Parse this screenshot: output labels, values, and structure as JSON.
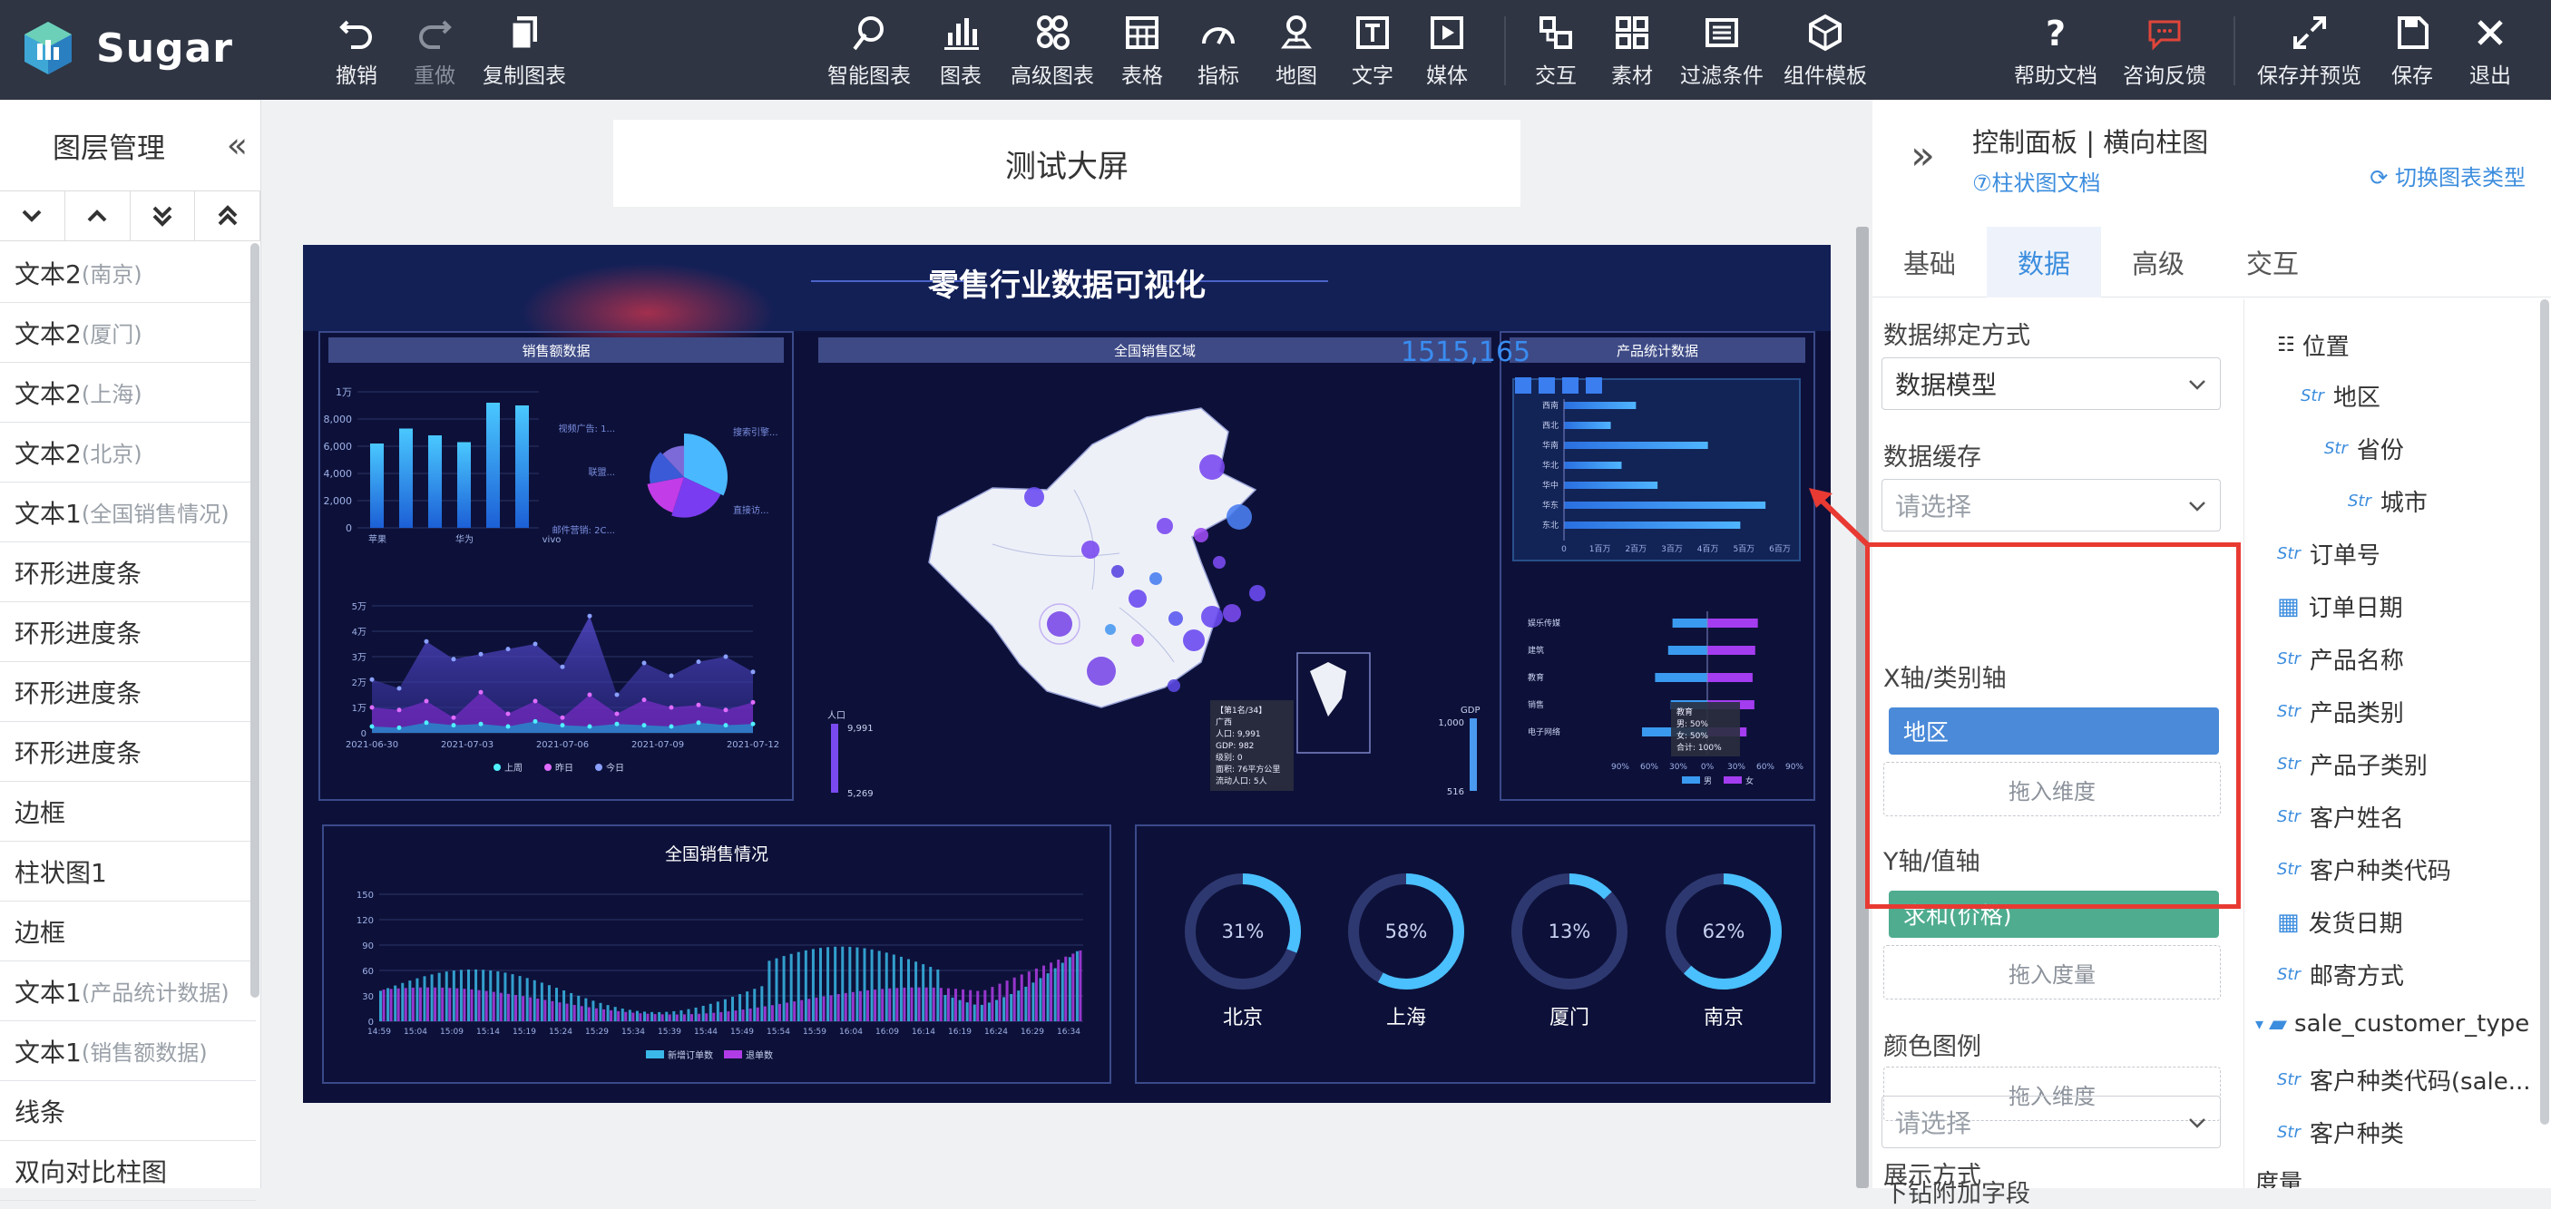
{
  "app": {
    "name": "Sugar"
  },
  "toolbar": {
    "undo": "撤销",
    "redo": "重做",
    "copy_chart": "复制图表",
    "smart_chart": "智能图表",
    "chart": "图表",
    "advanced_chart": "高级图表",
    "table": "表格",
    "indicator": "指标",
    "map": "地图",
    "text": "文字",
    "media": "媒体",
    "interaction": "交互",
    "material": "素材",
    "filter": "过滤条件",
    "component_template": "组件模板",
    "help_docs": "帮助文档",
    "consult": "咨询反馈",
    "save_preview": "保存并预览",
    "save": "保存",
    "exit": "退出"
  },
  "sidebar": {
    "title": "图层管理",
    "layers": [
      {
        "name": "文本2",
        "sub": "(南京)"
      },
      {
        "name": "文本2",
        "sub": "(厦门)"
      },
      {
        "name": "文本2",
        "sub": "(上海)"
      },
      {
        "name": "文本2",
        "sub": "(北京)"
      },
      {
        "name": "文本1",
        "sub": "(全国销售情况)"
      },
      {
        "name": "环形进度条",
        "sub": ""
      },
      {
        "name": "环形进度条",
        "sub": ""
      },
      {
        "name": "环形进度条",
        "sub": ""
      },
      {
        "name": "环形进度条",
        "sub": ""
      },
      {
        "name": "边框",
        "sub": ""
      },
      {
        "name": "柱状图1",
        "sub": ""
      },
      {
        "name": "边框",
        "sub": ""
      },
      {
        "name": "文本1",
        "sub": "(产品统计数据)"
      },
      {
        "name": "文本1",
        "sub": "(销售额数据)"
      },
      {
        "name": "线条",
        "sub": ""
      },
      {
        "name": "双向对比柱图",
        "sub": ""
      }
    ]
  },
  "canvas": {
    "title": "测试大屏"
  },
  "dashboard": {
    "title": "零售行业数据可视化",
    "panel_sales": "销售额数据",
    "panel_region": "全国销售区域",
    "panel_product": "产品统计数据",
    "big_number": "1515,165",
    "national_sales": "全国销售情况",
    "bar_yticks": [
      "1万",
      "8,000",
      "6,000",
      "4,000",
      "2,000",
      "0"
    ],
    "bar_xlabels": [
      "苹果",
      "华为",
      "vivo"
    ],
    "bar_values": [
      6200,
      7300,
      6800,
      6300,
      9200,
      9000
    ],
    "pie_labels": [
      "搜索引擎...",
      "视频广告: 1...",
      "联盟...",
      "直接访...",
      "邮件营销: 2C..."
    ],
    "area_yticks": [
      "5万",
      "4万",
      "3万",
      "2万",
      "1万",
      "0"
    ],
    "area_xlabels": [
      "2021-06-30",
      "2021-07-03",
      "2021-07-06",
      "2021-07-09",
      "2021-07-12"
    ],
    "area_legend": [
      "上周",
      "昨日",
      "今日"
    ],
    "map_legend_left": {
      "label": "人口",
      "max": "9,991",
      "min": "5,269"
    },
    "map_legend_right": {
      "label": "GDP",
      "max": "1,000",
      "min": "516"
    },
    "map_tooltip": [
      "【第1名/34】",
      "广西",
      "人口: 9,991",
      "GDP: 982",
      "级别: 0",
      "面积: 76平方公里",
      "流动人口: 5人"
    ],
    "hbar_categories": [
      "西南",
      "西北",
      "华南",
      "华北",
      "华中",
      "华东",
      "东北"
    ],
    "hbar_values": [
      2.0,
      1.3,
      4.0,
      1.6,
      2.6,
      5.6,
      4.9
    ],
    "hbar_ticks": [
      "0",
      "1百万",
      "2百万",
      "3百万",
      "4百万",
      "5百万",
      "6百万"
    ],
    "compare_categories": [
      "娱乐传媒",
      "建筑",
      "教育",
      "销售",
      "电子网络"
    ],
    "compare_ticks": [
      "90%",
      "60%",
      "30%",
      "0%",
      "30%",
      "60%",
      "90%"
    ],
    "compare_legend": [
      "男",
      "女"
    ],
    "compare_tooltip": [
      "教育",
      "男: 50%",
      "女: 50%",
      "合计: 100%"
    ],
    "national_yticks": [
      "150",
      "120",
      "90",
      "60",
      "30",
      "0"
    ],
    "national_xticks": [
      "14:59",
      "15:04",
      "15:09",
      "15:14",
      "15:19",
      "15:24",
      "15:29",
      "15:34",
      "15:39",
      "15:44",
      "15:49",
      "15:54",
      "15:59",
      "16:04",
      "16:09",
      "16:14",
      "16:19",
      "16:24",
      "16:29",
      "16:34"
    ],
    "national_legend": [
      "新增订单数",
      "退单数"
    ],
    "rings": [
      {
        "pct": 31,
        "label": "31%",
        "city": "北京"
      },
      {
        "pct": 58,
        "label": "58%",
        "city": "上海"
      },
      {
        "pct": 13,
        "label": "13%",
        "city": "厦门"
      },
      {
        "pct": 62,
        "label": "62%",
        "city": "南京"
      }
    ]
  },
  "panel": {
    "title": "控制面板 | 横向柱图",
    "doc_link": "⑦柱状图文档",
    "switch_type": "切换图表类型",
    "tabs": [
      "基础",
      "数据",
      "高级",
      "交互"
    ],
    "active_tab": "数据",
    "binding_label": "数据绑定方式",
    "binding_value": "数据模型",
    "cache_label": "数据缓存",
    "cache_placeholder": "请选择",
    "x_axis_label": "X轴/类别轴",
    "x_axis_chip": "地区",
    "x_drop": "拖入维度",
    "y_axis_label": "Y轴/值轴",
    "y_axis_chip": "求和(价格)",
    "y_drop": "拖入度量",
    "color_legend_label": "颜色图例",
    "color_drop": "拖入维度",
    "display_label": "展示方式",
    "display_placeholder": "请选择",
    "extra_label": "下钻附加字段",
    "fields": {
      "position": "位置",
      "region": "地区",
      "province": "省份",
      "city": "城市",
      "order_no": "订单号",
      "order_date": "订单日期",
      "product_name": "产品名称",
      "product_cat": "产品类别",
      "product_subcat": "产品子类别",
      "customer_name": "客户姓名",
      "customer_type_code": "客户种类代码",
      "ship_date": "发货日期",
      "ship_mode": "邮寄方式",
      "folder": "sale_customer_type",
      "customer_type_code2": "客户种类代码(sale...",
      "customer_type": "客户种类",
      "measure": "度量",
      "str_tag": "Str"
    }
  },
  "colors": {
    "topbar": "#2f3543",
    "accent": "#3c8dde",
    "x_chip": "#4a8ad9",
    "y_chip": "#4fac8f",
    "highlight": "#e83a32",
    "screen_bg": "#0d1139"
  }
}
